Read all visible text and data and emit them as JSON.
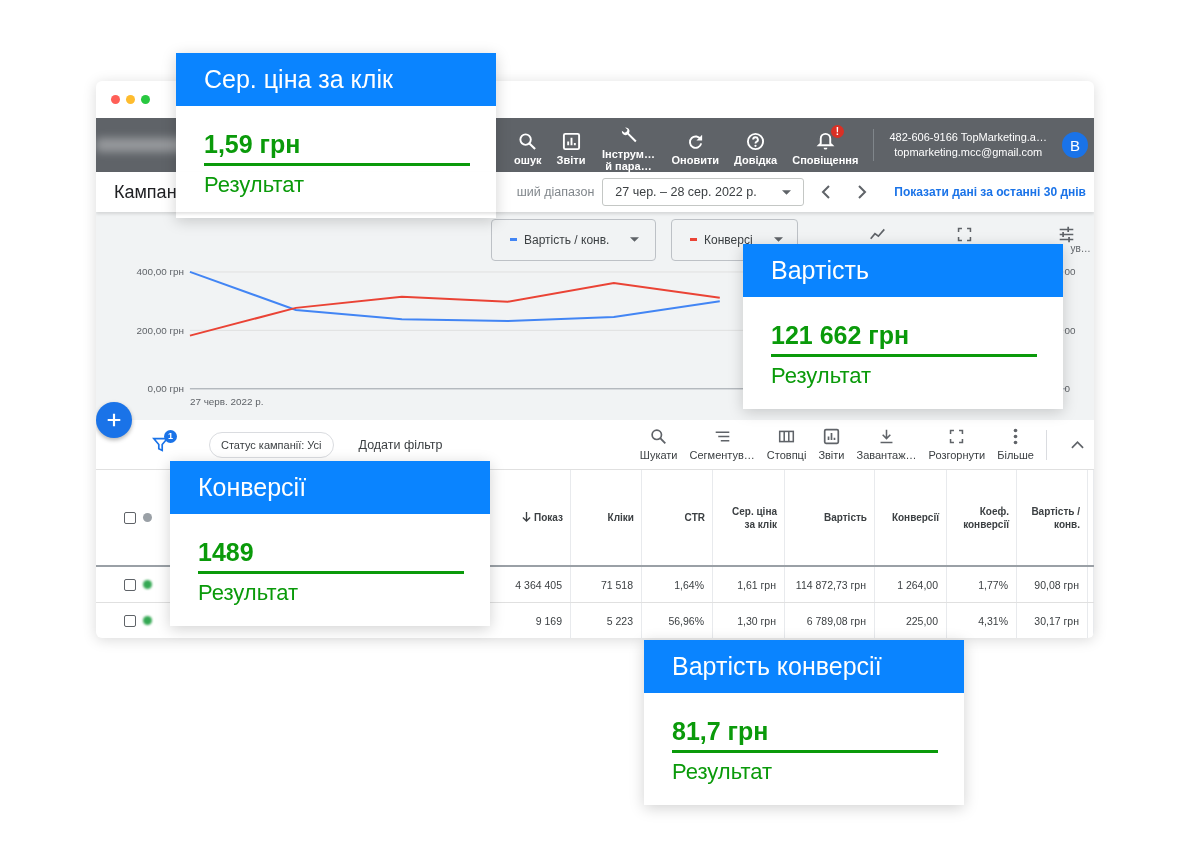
{
  "toolbar": {
    "items": [
      {
        "kind": "search",
        "label": "ошук"
      },
      {
        "kind": "reports",
        "label": "Звіти"
      },
      {
        "kind": "tools",
        "label": "Інструм… й пара…"
      },
      {
        "kind": "refresh",
        "label": "Оновити"
      },
      {
        "kind": "help",
        "label": "Довідка"
      },
      {
        "kind": "notifications",
        "label": "Сповіщення",
        "badge": "!"
      }
    ],
    "account": {
      "line1": "482-606-9166 TopMarketing.a…",
      "line2": "topmarketing.mcc@gmail.com",
      "avatar": "B"
    }
  },
  "subheader": {
    "title": "Кампан",
    "range_label": "ший діапазон",
    "date_range": "27 чер. – 28 сер. 2022 р.",
    "link": "Показати дані за останні 30 днів"
  },
  "chart": {
    "adjust_label": "ув…",
    "right_axis_labels": [
      "00",
      "00",
      "0"
    ],
    "start_date": "27 черв. 2022 р.",
    "chart_data": {
      "type": "line",
      "ylim": [
        0,
        400
      ],
      "yticks": [
        {
          "value": 0,
          "label": "0,00 грн"
        },
        {
          "value": 200,
          "label": "200,00 грн"
        },
        {
          "value": 400,
          "label": "400,00 грн"
        }
      ],
      "series": [
        {
          "name": "Вартість / конв.",
          "color": "#4285f4",
          "values": [
            400,
            270,
            238,
            232,
            246,
            300
          ]
        },
        {
          "name": "Конверсі",
          "color": "#ea4335",
          "values": [
            182,
            277,
            315,
            298,
            362,
            312
          ]
        }
      ]
    }
  },
  "filter_bar": {
    "filter_badge": "1",
    "chip": "Статус кампанії: Усі",
    "add_filter": "Додати фільтр",
    "actions": [
      {
        "kind": "search",
        "label": "Шукати"
      },
      {
        "kind": "segment",
        "label": "Сегментув…"
      },
      {
        "kind": "columns",
        "label": "Стовпці"
      },
      {
        "kind": "reports",
        "label": "Звіти"
      },
      {
        "kind": "download",
        "label": "Завантаж…"
      },
      {
        "kind": "expand",
        "label": "Розгорнути"
      },
      {
        "kind": "more",
        "label": "Більше"
      }
    ]
  },
  "table": {
    "all_checked": false,
    "columns": [
      {
        "label": "Показ",
        "sorted": true
      },
      {
        "label": "Кліки",
        "sorted": false
      },
      {
        "label": "CTR",
        "sorted": false
      },
      {
        "label": "Сер. ціна за клік",
        "sorted": false
      },
      {
        "label": "Вартість",
        "sorted": false
      },
      {
        "label": "Конверсії",
        "sorted": false
      },
      {
        "label": "Коеф. конверсії",
        "sorted": false
      },
      {
        "label": "Вартість / конв.",
        "sorted": false
      }
    ],
    "rows": [
      {
        "checked": false,
        "color": "#34a853",
        "cells": [
          "4 364 405",
          "71 518",
          "1,64%",
          "1,61 грн",
          "114 872,73 грн",
          "1 264,00",
          "1,77%",
          "90,08 грн"
        ]
      },
      {
        "checked": false,
        "color": "#34a853",
        "cells": [
          "9 169",
          "5 223",
          "56,96%",
          "1,30 грн",
          "6 789,08 грн",
          "225,00",
          "4,31%",
          "30,17 грн"
        ]
      }
    ]
  },
  "callouts": [
    {
      "title": "Сер. ціна за клік",
      "value": "1,59 грн",
      "caption": "Результат"
    },
    {
      "title": "Вартість",
      "value": "121 662 грн",
      "caption": "Результат"
    },
    {
      "title": "Конверсії",
      "value": "1489",
      "caption": "Результат"
    },
    {
      "title": "Вартість конверсії",
      "value": "81,7 грн",
      "caption": "Результат"
    }
  ]
}
